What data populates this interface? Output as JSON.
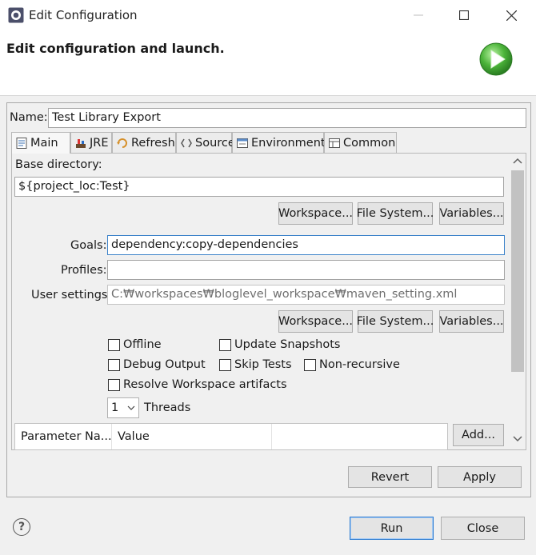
{
  "window": {
    "title": "Edit Configuration",
    "minimize": "—",
    "maximize": "☐",
    "close": "✕"
  },
  "header": {
    "title": "Edit configuration and launch."
  },
  "name_field": {
    "label": "Name:",
    "value": "Test Library Export"
  },
  "tabs": [
    {
      "label": "Main",
      "icon": "main-tab-icon"
    },
    {
      "label": "JRE",
      "icon": "jre-icon"
    },
    {
      "label": "Refresh",
      "icon": "refresh-icon"
    },
    {
      "label": "Source",
      "icon": "source-icon"
    },
    {
      "label": "Environment",
      "icon": "environment-icon"
    },
    {
      "label": "Common",
      "icon": "common-icon"
    }
  ],
  "main": {
    "base_directory_label": "Base directory:",
    "base_directory_value": "${project_loc:Test}",
    "buttons_row1": [
      "Workspace...",
      "File System...",
      "Variables..."
    ],
    "goals_label": "Goals:",
    "goals_value": "dependency:copy-dependencies",
    "profiles_label": "Profiles:",
    "profiles_value": "",
    "user_settings_label": "User settings:",
    "user_settings_value": "C:₩workspaces₩bloglevel_workspace₩maven_setting.xml",
    "buttons_row2": [
      "Workspace...",
      "File System...",
      "Variables..."
    ],
    "checkboxes": {
      "offline": {
        "label": "Offline",
        "checked": false
      },
      "update_snapshots": {
        "label": "Update Snapshots",
        "checked": false
      },
      "debug_output": {
        "label": "Debug Output",
        "checked": false
      },
      "skip_tests": {
        "label": "Skip Tests",
        "checked": false
      },
      "non_recursive": {
        "label": "Non-recursive",
        "checked": false
      },
      "resolve_workspace": {
        "label": "Resolve Workspace artifacts",
        "checked": false
      }
    },
    "threads_value": "1",
    "threads_label": "Threads",
    "params_table": {
      "columns": [
        "Parameter Na...",
        "Value",
        ""
      ]
    },
    "add_button": "Add..."
  },
  "actions": {
    "revert": "Revert",
    "apply": "Apply"
  },
  "footer": {
    "help": "?",
    "run": "Run",
    "close": "Close"
  },
  "colors": {
    "accent": "#3c82c9",
    "run_green": "#3fa535"
  }
}
